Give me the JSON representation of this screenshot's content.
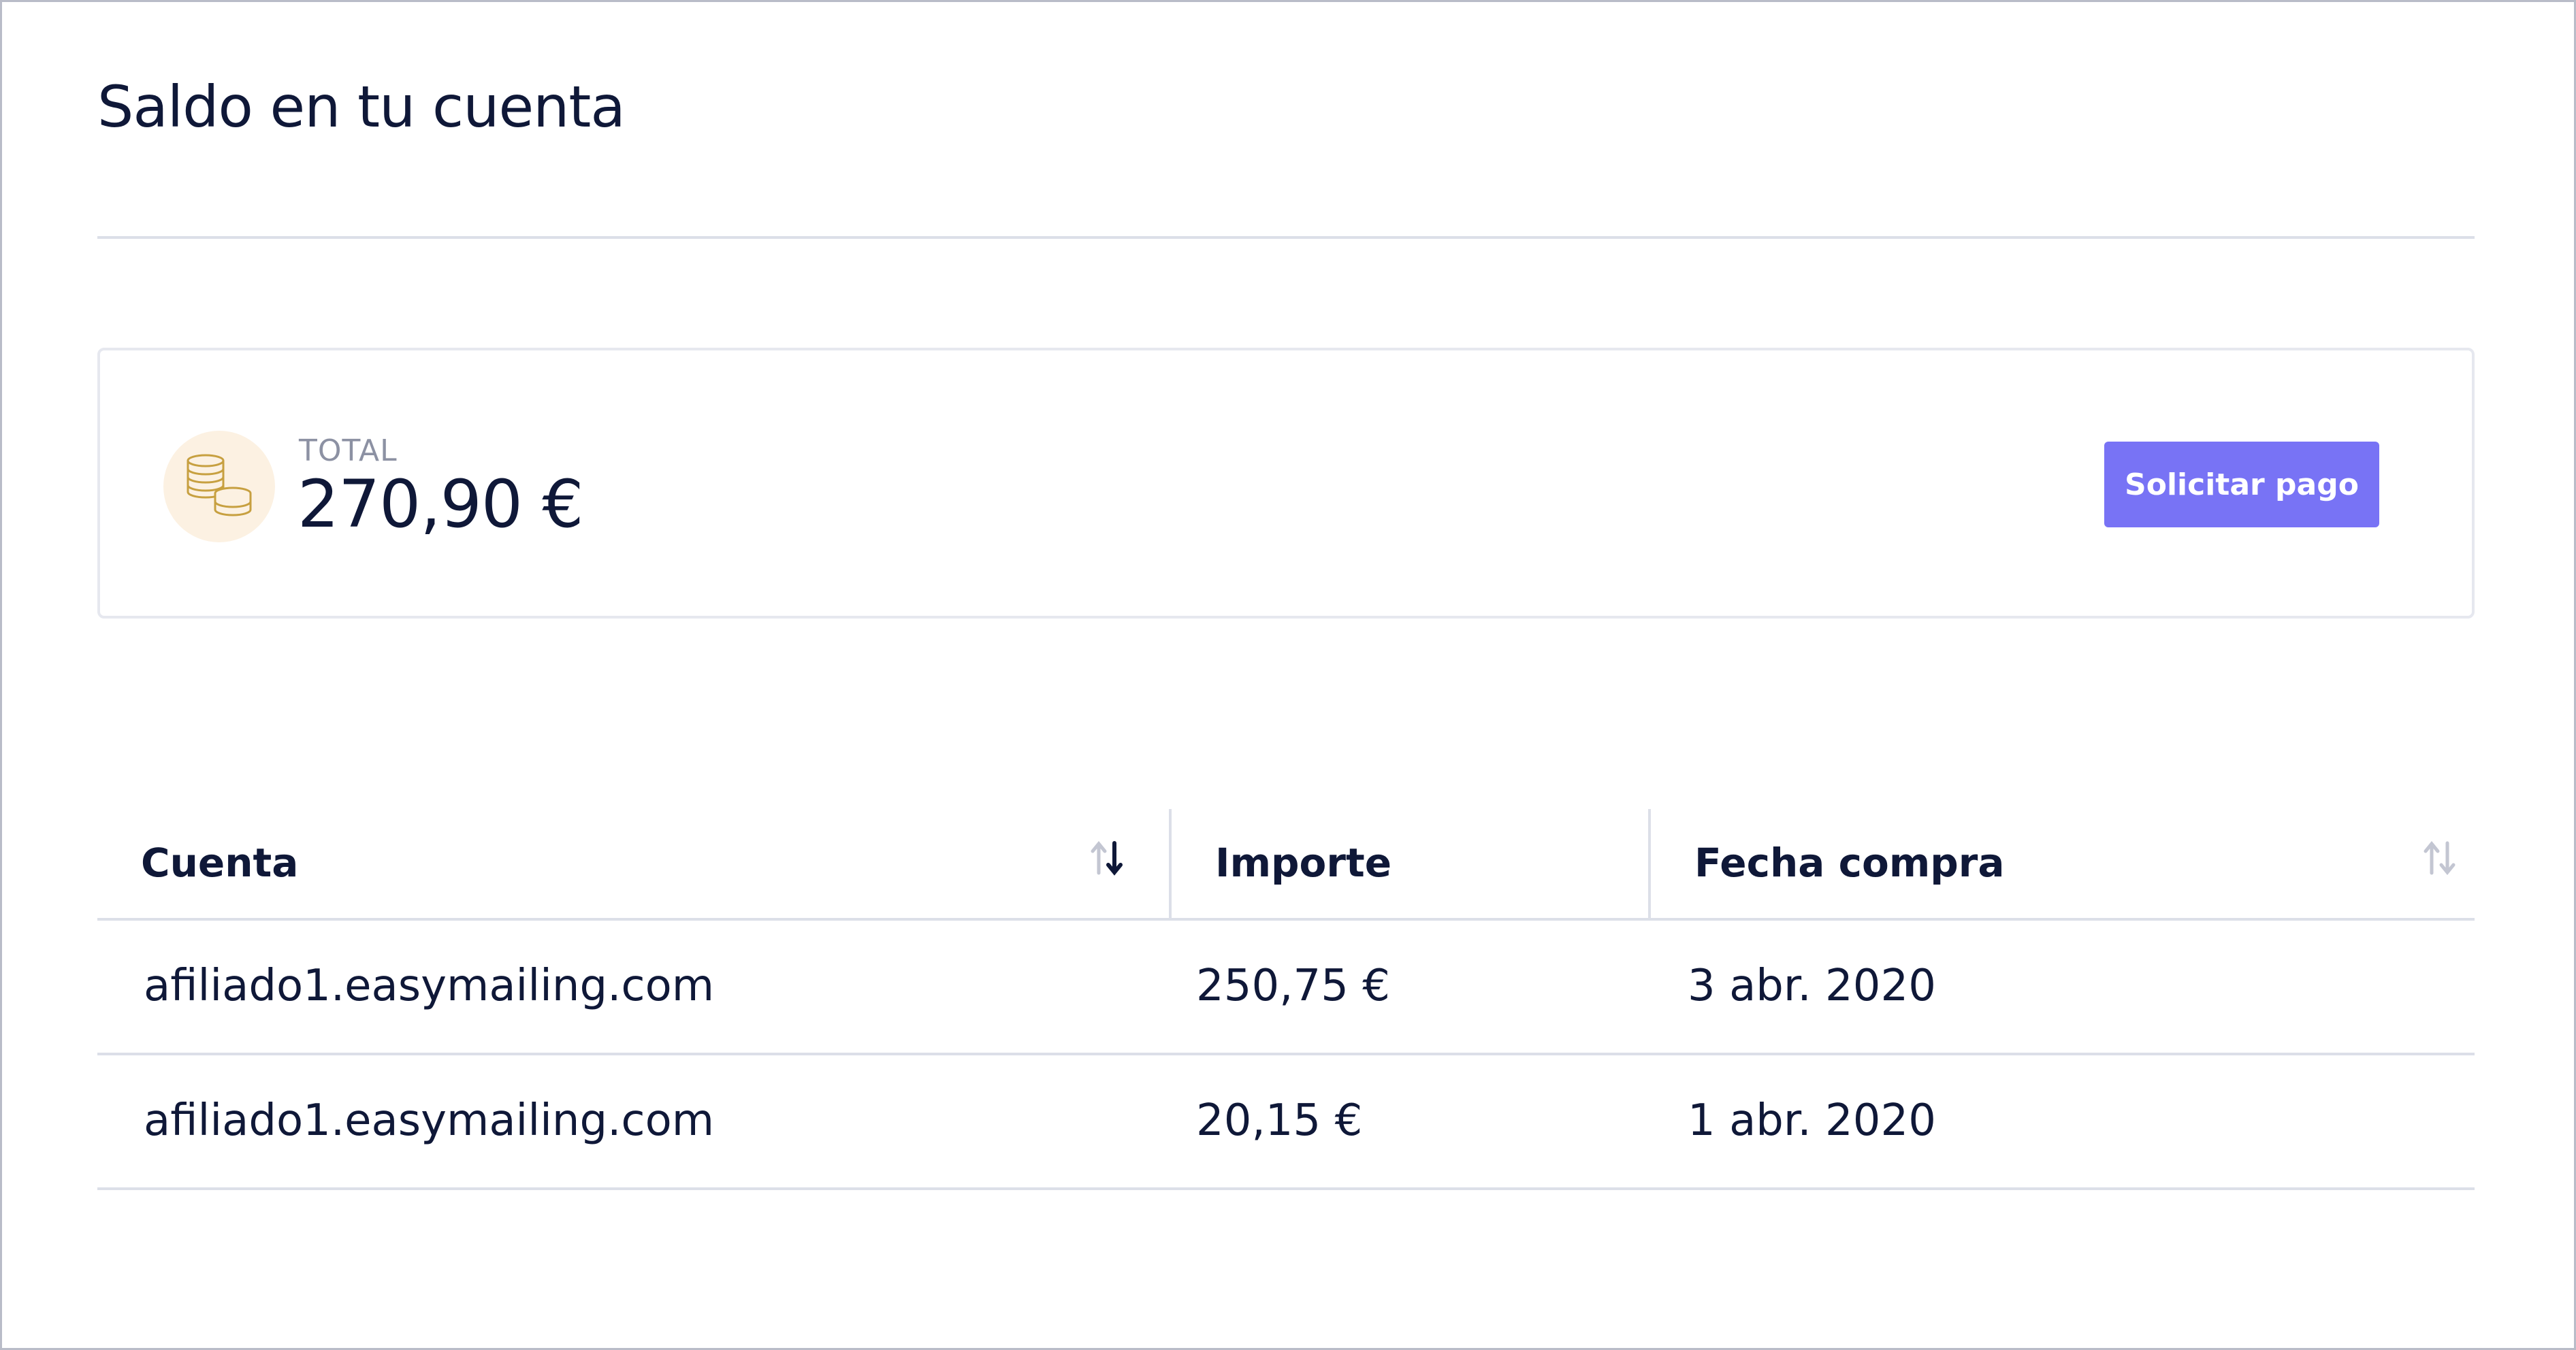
{
  "page": {
    "title": "Saldo en tu cuenta"
  },
  "balance": {
    "icon": "coins-icon",
    "label": "TOTAL",
    "amount": "270,90 €",
    "button_label": "Solicitar pago"
  },
  "table": {
    "columns": [
      {
        "key": "cuenta",
        "label": "Cuenta",
        "sortable": true,
        "sort": "desc"
      },
      {
        "key": "importe",
        "label": "Importe",
        "sortable": false
      },
      {
        "key": "fecha",
        "label": "Fecha compra",
        "sortable": true,
        "sort": "none"
      }
    ],
    "rows": [
      {
        "cuenta": "afiliado1.easymailing.com",
        "importe": "250,75 €",
        "fecha": "3 abr. 2020"
      },
      {
        "cuenta": "afiliado1.easymailing.com",
        "importe": "20,15 €",
        "fecha": "1 abr. 2020"
      }
    ]
  },
  "colors": {
    "text": "#0f1838",
    "muted": "#8c91a3",
    "accent": "#7873f5",
    "divider": "#dcdfe8",
    "coin_badge_bg": "#fcf1e2",
    "coin_stroke": "#c7a040"
  }
}
